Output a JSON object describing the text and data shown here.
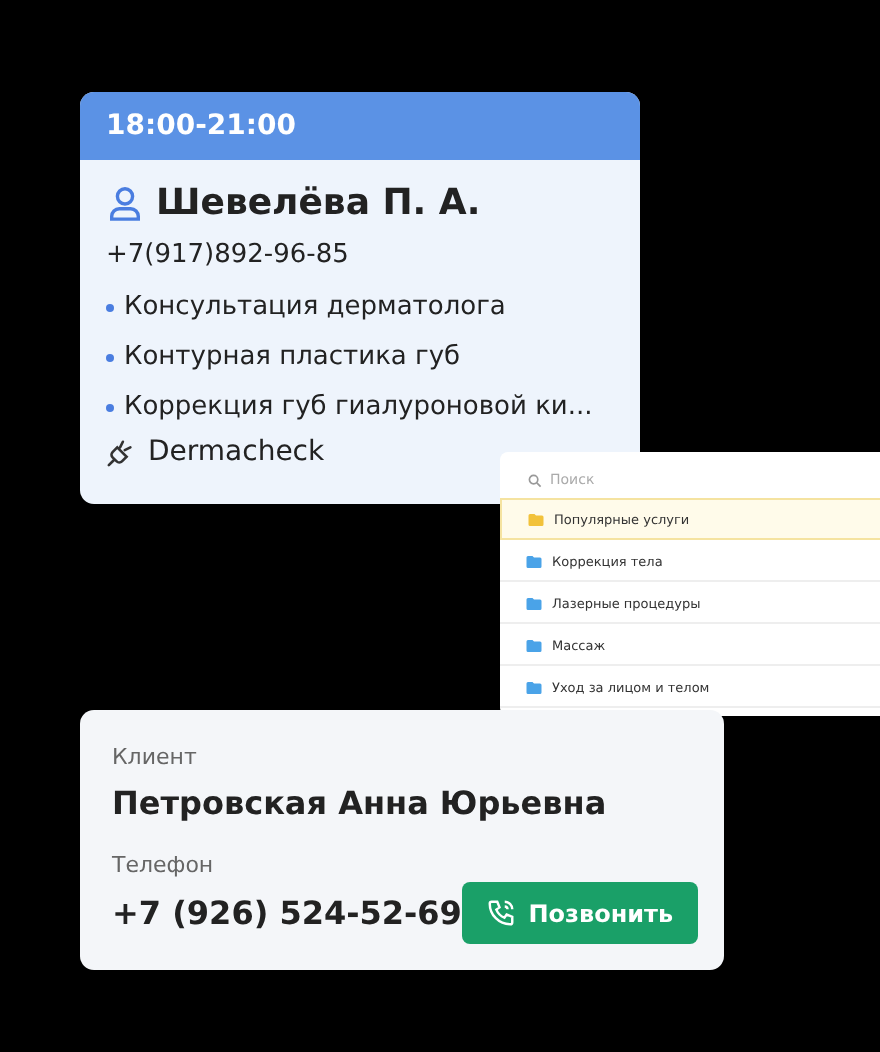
{
  "appointment": {
    "time": "18:00-21:00",
    "client": "Шевелёва П. А.",
    "phone": "+7(917)892-96-85",
    "services": [
      "Консультация дерматолога",
      "Контурная пластика губ",
      "Коррекция губ гиалуроновой ки..."
    ],
    "equipment": "Dermacheck"
  },
  "catalog": {
    "search": {
      "placeholder": "Поиск"
    },
    "folders": [
      {
        "label": "Популярные услуги",
        "selected": true
      },
      {
        "label": "Коррекция тела",
        "selected": false
      },
      {
        "label": "Лазерные процедуры",
        "selected": false
      },
      {
        "label": "Массаж",
        "selected": false
      },
      {
        "label": "Уход за лицом и телом",
        "selected": false
      }
    ]
  },
  "client_card": {
    "client_label": "Клиент",
    "client_name": "Петровская Анна Юрьевна",
    "phone_label": "Телефон",
    "phone": "+7 (926) 524-52-69",
    "call_button": "Позвонить"
  }
}
